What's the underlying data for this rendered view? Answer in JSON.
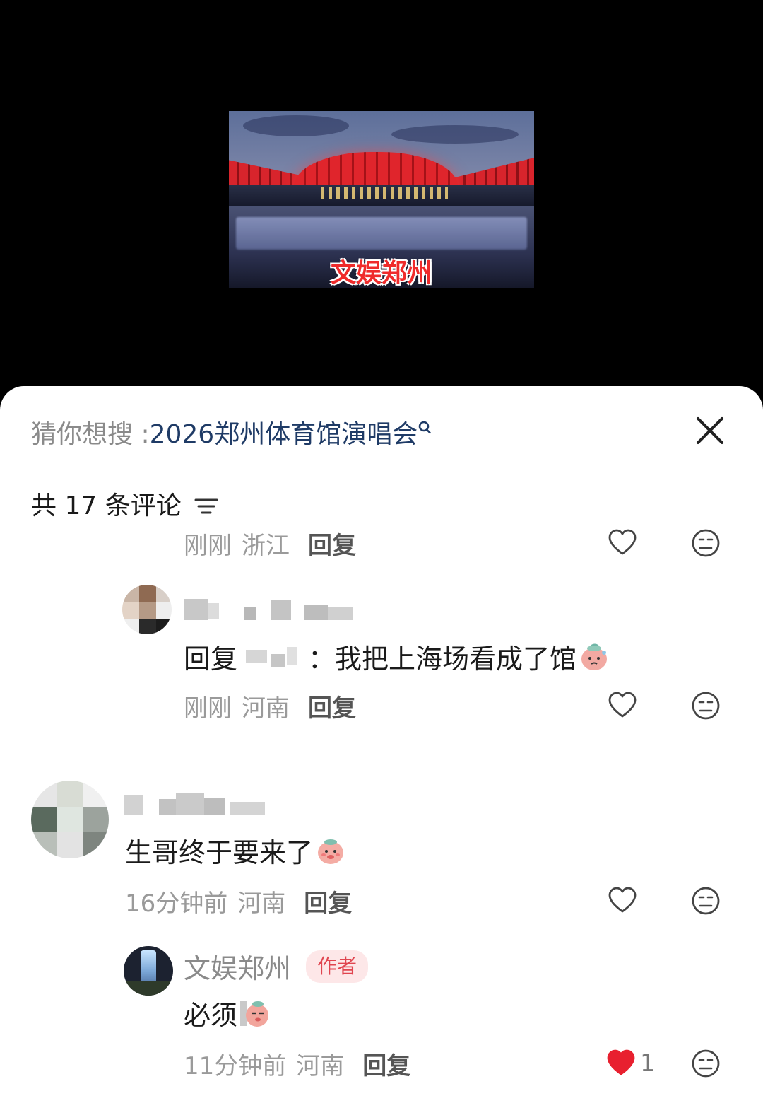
{
  "video": {
    "caption": "文娱郑州"
  },
  "search": {
    "prefix": "猜你想搜 : ",
    "term": "2026郑州体育馆演唱会"
  },
  "comments_header": {
    "count_label": "共 17 条评论"
  },
  "top_fragment": {
    "time": "刚刚",
    "region": "浙江",
    "reply_label": "回复"
  },
  "reply_1": {
    "reply_prefix": "回复",
    "text": "：我把上海场看成了馆",
    "time": "刚刚",
    "region": "河南",
    "reply_label": "回复"
  },
  "comment_2": {
    "text": "生哥终于要来了",
    "time": "16分钟前",
    "region": "河南",
    "reply_label": "回复"
  },
  "reply_2": {
    "username": "文娱郑州",
    "author_tag": "作者",
    "text": "必须",
    "time": "11分钟前",
    "region": "河南",
    "reply_label": "回复",
    "like_count": "1"
  },
  "colors": {
    "accent": "#1f3b66",
    "like_active": "#e8202f",
    "author_tag": "#e0454f"
  },
  "icons": [
    "search-icon",
    "close-icon",
    "sort-icon",
    "heart-icon",
    "dislike-icon",
    "heart-filled-icon",
    "peach-emoji-icon"
  ]
}
